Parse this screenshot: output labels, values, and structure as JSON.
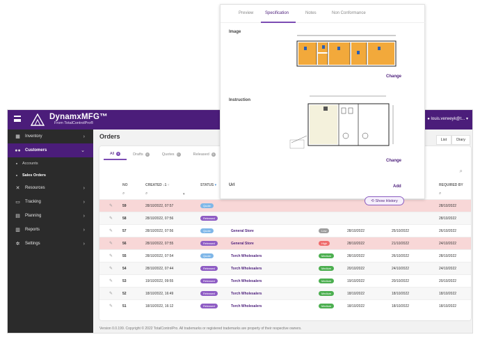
{
  "app": {
    "title": "DynamxMFG™",
    "subtitle": "From TotalControlPro®",
    "user": "louis.verweyk@t..."
  },
  "sidebar": {
    "items": [
      {
        "label": "Inventory",
        "icon": "warehouse-icon",
        "glyph": "▦"
      },
      {
        "label": "Customers",
        "icon": "people-icon",
        "glyph": "●●"
      },
      {
        "label": "Resources",
        "icon": "tools-icon",
        "glyph": "✕"
      },
      {
        "label": "Tracking",
        "icon": "monitor-icon",
        "glyph": "▭"
      },
      {
        "label": "Planning",
        "icon": "calendar-icon",
        "glyph": "▤"
      },
      {
        "label": "Reports",
        "icon": "chart-icon",
        "glyph": "▥"
      },
      {
        "label": "Settings",
        "icon": "gear-icon",
        "glyph": "✲"
      }
    ],
    "sub_items": [
      "Accounts",
      "Sales Orders"
    ]
  },
  "page": {
    "title": "Orders",
    "views": [
      "List",
      "Diary"
    ],
    "footer": "Version 0.0.199. Copyright © 2022 TotalControlPro. All trademarks or registered trademarks are property of their respective owners."
  },
  "tabs": [
    {
      "label": "All",
      "count": "9"
    },
    {
      "label": "Drafts",
      "count": "0"
    },
    {
      "label": "Quotes",
      "count": "0"
    },
    {
      "label": "Released",
      "count": "0"
    }
  ],
  "table": {
    "headers": {
      "no": "NO",
      "created": "CREATED ↓1",
      "status": "STATUS",
      "required": "REQUIRED BY"
    },
    "rows": [
      {
        "no": "59",
        "created": "28/10/2022, 07:57",
        "status": "Quote",
        "status_color": "#7fb7e8",
        "customer": "",
        "priority": "",
        "priority_color": "",
        "d1": "",
        "d2": "",
        "d3": "28/10/2022",
        "style": "high"
      },
      {
        "no": "58",
        "created": "28/10/2022, 07:56",
        "status": "Released",
        "status_color": "#8e5cc4",
        "customer": "",
        "priority": "",
        "priority_color": "",
        "d1": "",
        "d2": "",
        "d3": "28/10/2022",
        "style": "odd"
      },
      {
        "no": "57",
        "created": "28/10/2022, 07:56",
        "status": "Quote",
        "status_color": "#7fb7e8",
        "customer": "General Store",
        "priority": "Low",
        "priority_color": "#9e9e9e",
        "d1": "28/10/2022",
        "d2": "25/10/2022",
        "d3": "26/10/2022",
        "style": ""
      },
      {
        "no": "56",
        "created": "28/10/2022, 07:55",
        "status": "Released",
        "status_color": "#8e5cc4",
        "customer": "General Store",
        "priority": "High",
        "priority_color": "#ef6b6b",
        "d1": "28/10/2022",
        "d2": "21/10/2022",
        "d3": "24/10/2022",
        "style": "high"
      },
      {
        "no": "55",
        "created": "28/10/2022, 07:54",
        "status": "Quote",
        "status_color": "#7fb7e8",
        "customer": "Torch Wholesalers",
        "priority": "Medium",
        "priority_color": "#4caf50",
        "d1": "28/10/2022",
        "d2": "26/10/2022",
        "d3": "28/10/2022",
        "style": ""
      },
      {
        "no": "54",
        "created": "28/10/2022, 07:44",
        "status": "Released",
        "status_color": "#8e5cc4",
        "customer": "Torch Wholesalers",
        "priority": "Medium",
        "priority_color": "#4caf50",
        "d1": "20/10/2022",
        "d2": "24/10/2022",
        "d3": "24/10/2022",
        "style": "odd"
      },
      {
        "no": "53",
        "created": "19/10/2022, 09:55",
        "status": "Released",
        "status_color": "#8e5cc4",
        "customer": "Torch Wholesalers",
        "priority": "Medium",
        "priority_color": "#4caf50",
        "d1": "19/10/2022",
        "d2": "20/10/2022",
        "d3": "20/10/2022",
        "style": ""
      },
      {
        "no": "52",
        "created": "18/10/2022, 16:49",
        "status": "Released",
        "status_color": "#8e5cc4",
        "customer": "Torch Wholesalers",
        "priority": "Medium",
        "priority_color": "#4caf50",
        "d1": "18/10/2022",
        "d2": "18/10/2022",
        "d3": "18/10/2022",
        "style": "odd"
      },
      {
        "no": "51",
        "created": "18/10/2022, 16:12",
        "status": "Released",
        "status_color": "#8e5cc4",
        "customer": "Torch Wholesalers",
        "priority": "Medium",
        "priority_color": "#4caf50",
        "d1": "18/10/2022",
        "d2": "18/10/2022",
        "d3": "18/10/2022",
        "style": ""
      }
    ]
  },
  "panel": {
    "tabs": [
      "Preview",
      "Specification",
      "Notes",
      "Non Conformance"
    ],
    "active_tab": "Specification",
    "image_label": "Image",
    "instruction_label": "Instruction",
    "url_label": "Url",
    "change_label": "Change",
    "add_label": "Add",
    "history_label": "⟲ Show History"
  }
}
